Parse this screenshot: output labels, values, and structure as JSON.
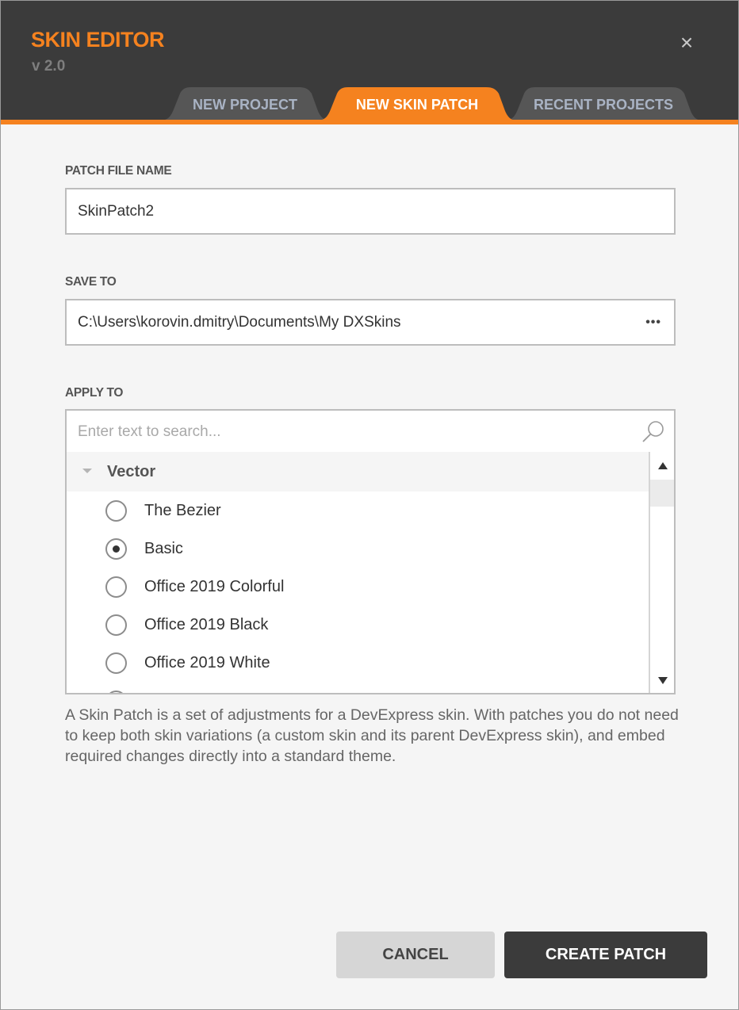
{
  "app": {
    "title": "SKIN EDITOR",
    "version": "v 2.0",
    "close_icon": "close-icon",
    "accent_color": "#f5821f",
    "header_color": "#3b3b3b"
  },
  "tabs": [
    {
      "label": "NEW PROJECT",
      "active": false
    },
    {
      "label": "NEW SKIN PATCH",
      "active": true
    },
    {
      "label": "RECENT PROJECTS",
      "active": false
    }
  ],
  "form": {
    "patch_file_name": {
      "label": "PATCH FILE NAME",
      "value": "SkinPatch2"
    },
    "save_to": {
      "label": "SAVE TO",
      "value": "C:\\Users\\korovin.dmitry\\Documents\\My DXSkins",
      "browse_label": "•••"
    },
    "apply_to": {
      "label": "APPLY TO",
      "search_placeholder": "Enter text to search...",
      "search_icon": "search-icon",
      "group": "Vector",
      "items": [
        {
          "label": "The Bezier",
          "checked": false
        },
        {
          "label": "Basic",
          "checked": true
        },
        {
          "label": "Office 2019 Colorful",
          "checked": false
        },
        {
          "label": "Office 2019 Black",
          "checked": false
        },
        {
          "label": "Office 2019 White",
          "checked": false
        }
      ]
    }
  },
  "description": "A Skin Patch is a set of adjustments for a DevExpress skin. With patches you do not need to keep both skin variations (a custom skin and its parent DevExpress skin), and embed required changes directly into a standard theme.",
  "buttons": {
    "cancel": "CANCEL",
    "create": "CREATE PATCH"
  }
}
